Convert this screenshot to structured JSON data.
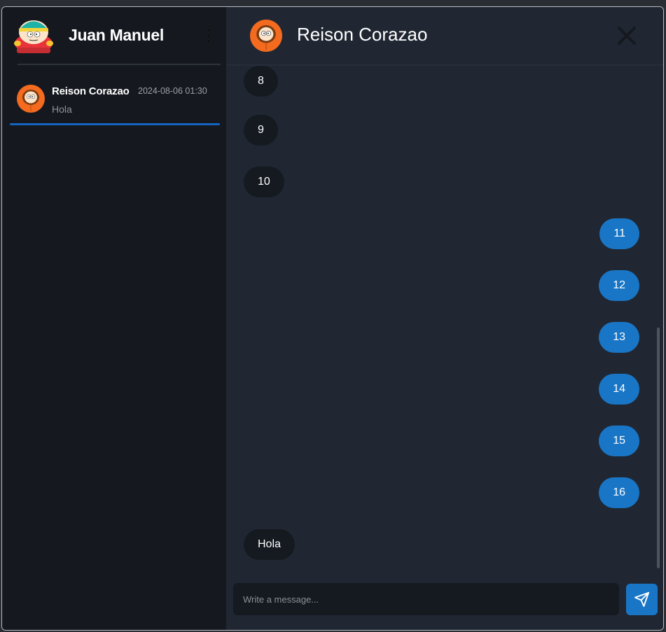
{
  "sidebar": {
    "user_name": "Juan Manuel",
    "avatar_icon": "cartman-avatar-icon",
    "menu_icon": "kebab-menu-icon",
    "chats": [
      {
        "name": "Reison Corazao",
        "time": "2024-08-06 01:30",
        "last_message": "Hola",
        "avatar_icon": "kenny-avatar-icon"
      }
    ]
  },
  "chat": {
    "title": "Reison Corazao",
    "avatar_icon": "kenny-avatar-icon",
    "close_icon": "close-icon",
    "messages": [
      {
        "text": "8",
        "direction": "in"
      },
      {
        "text": "9",
        "direction": "in"
      },
      {
        "text": "10",
        "direction": "in"
      },
      {
        "text": "11",
        "direction": "out"
      },
      {
        "text": "12",
        "direction": "out"
      },
      {
        "text": "13",
        "direction": "out"
      },
      {
        "text": "14",
        "direction": "out"
      },
      {
        "text": "15",
        "direction": "out"
      },
      {
        "text": "16",
        "direction": "out"
      },
      {
        "text": "Hola",
        "direction": "in"
      }
    ]
  },
  "composer": {
    "placeholder": "Write a message...",
    "value": "",
    "send_icon": "send-icon"
  },
  "colors": {
    "outgoing": "#1976c6",
    "incoming": "#151a20",
    "sidebar_bg": "#15191f",
    "main_bg": "#202733",
    "accent": "#1565c0"
  }
}
